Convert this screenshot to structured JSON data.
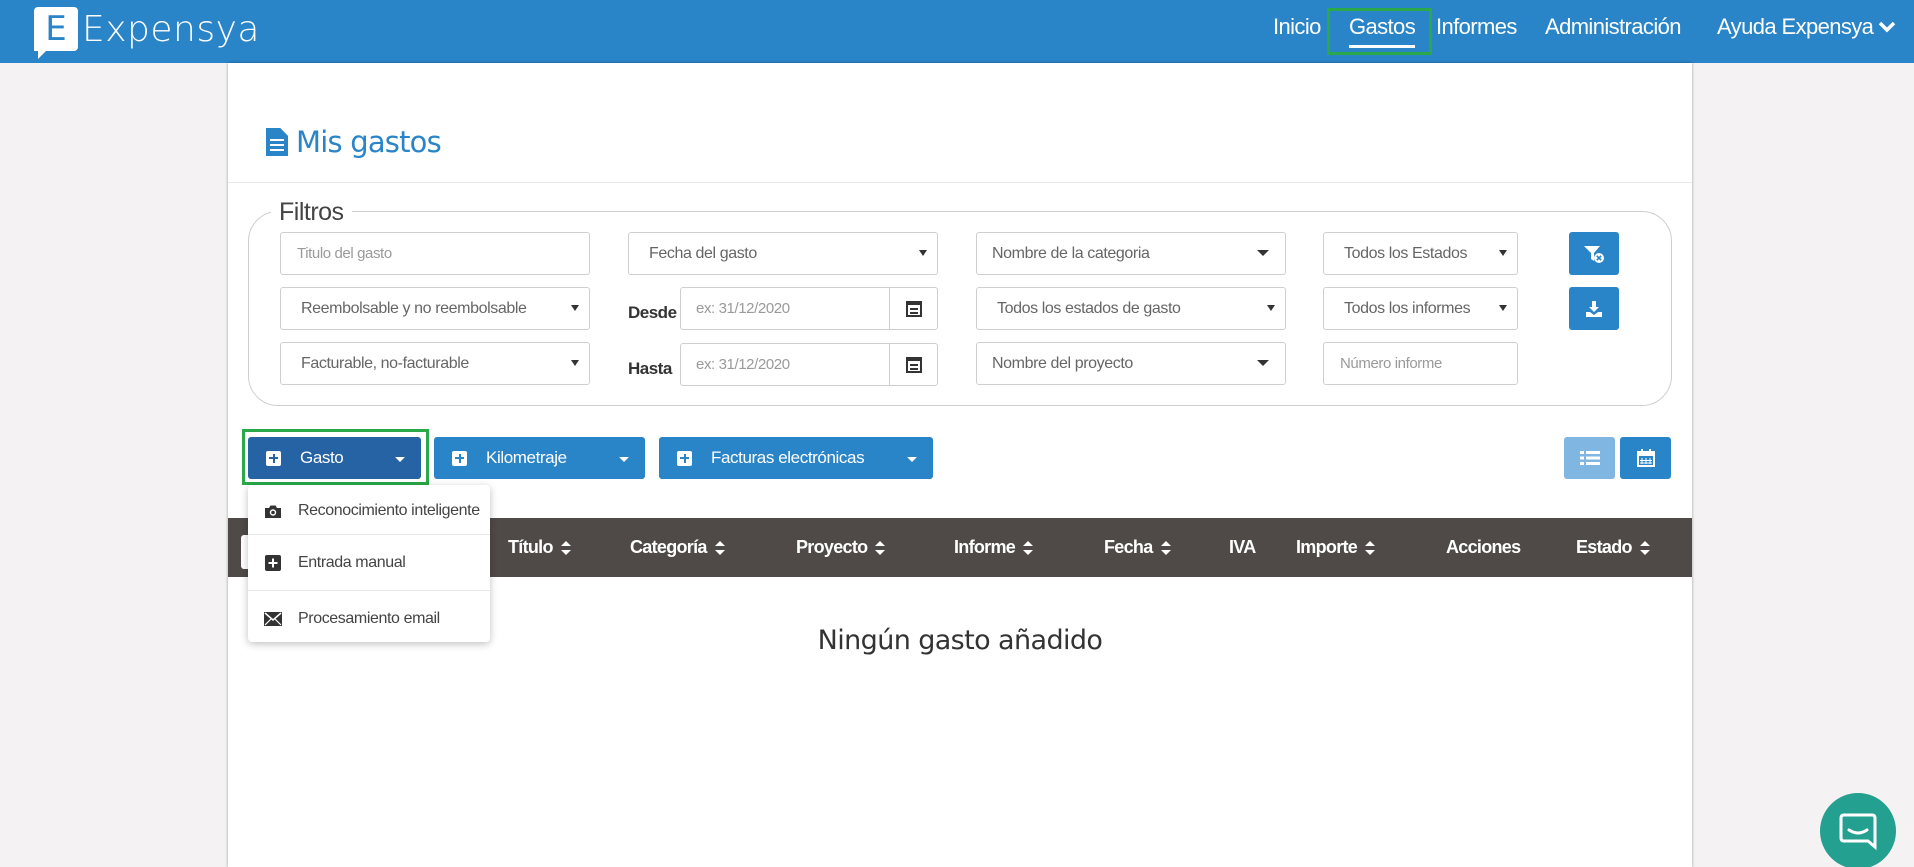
{
  "app": {
    "logo_letter": "E",
    "logo_text": "Expensya"
  },
  "nav": {
    "items": [
      "Inicio",
      "Gastos",
      "Informes",
      "Administración"
    ],
    "help_label": "Ayuda Expensya",
    "active": "Gastos"
  },
  "page": {
    "title": "Mis gastos"
  },
  "filters": {
    "legend": "Filtros",
    "title_placeholder": "Titulo del gasto",
    "date_select": "Fecha del gasto",
    "category_select": "Nombre de la categoria",
    "status_select": "Todos los Estados",
    "reimbursable_select": "Reembolsable y no reembolsable",
    "from_label": "Desde",
    "from_placeholder": "ex: 31/12/2020",
    "expense_status_select": "Todos los estados de gasto",
    "reports_select": "Todos los informes",
    "billable_select": "Facturable, no-facturable",
    "to_label": "Hasta",
    "to_placeholder": "ex: 31/12/2020",
    "project_select": "Nombre del proyecto",
    "report_number_placeholder": "Número informe"
  },
  "actions": {
    "expense_label": "Gasto",
    "mileage_label": "Kilometraje",
    "einvoices_label": "Facturas electrónicas"
  },
  "dropdown": {
    "items": [
      "Reconocimiento inteligente",
      "Entrada manual",
      "Procesamiento email"
    ]
  },
  "table": {
    "columns": [
      "Título",
      "Categoría",
      "Proyecto",
      "Informe",
      "Fecha",
      "IVA",
      "Importe",
      "Acciones",
      "Estado"
    ],
    "empty_message": "Ningún gasto añadido"
  },
  "colors": {
    "primary": "#2a84c8",
    "primary_dark": "#2563a4",
    "highlight": "#2aa84a",
    "table_header": "#4f4a47",
    "chat": "#24a090"
  }
}
